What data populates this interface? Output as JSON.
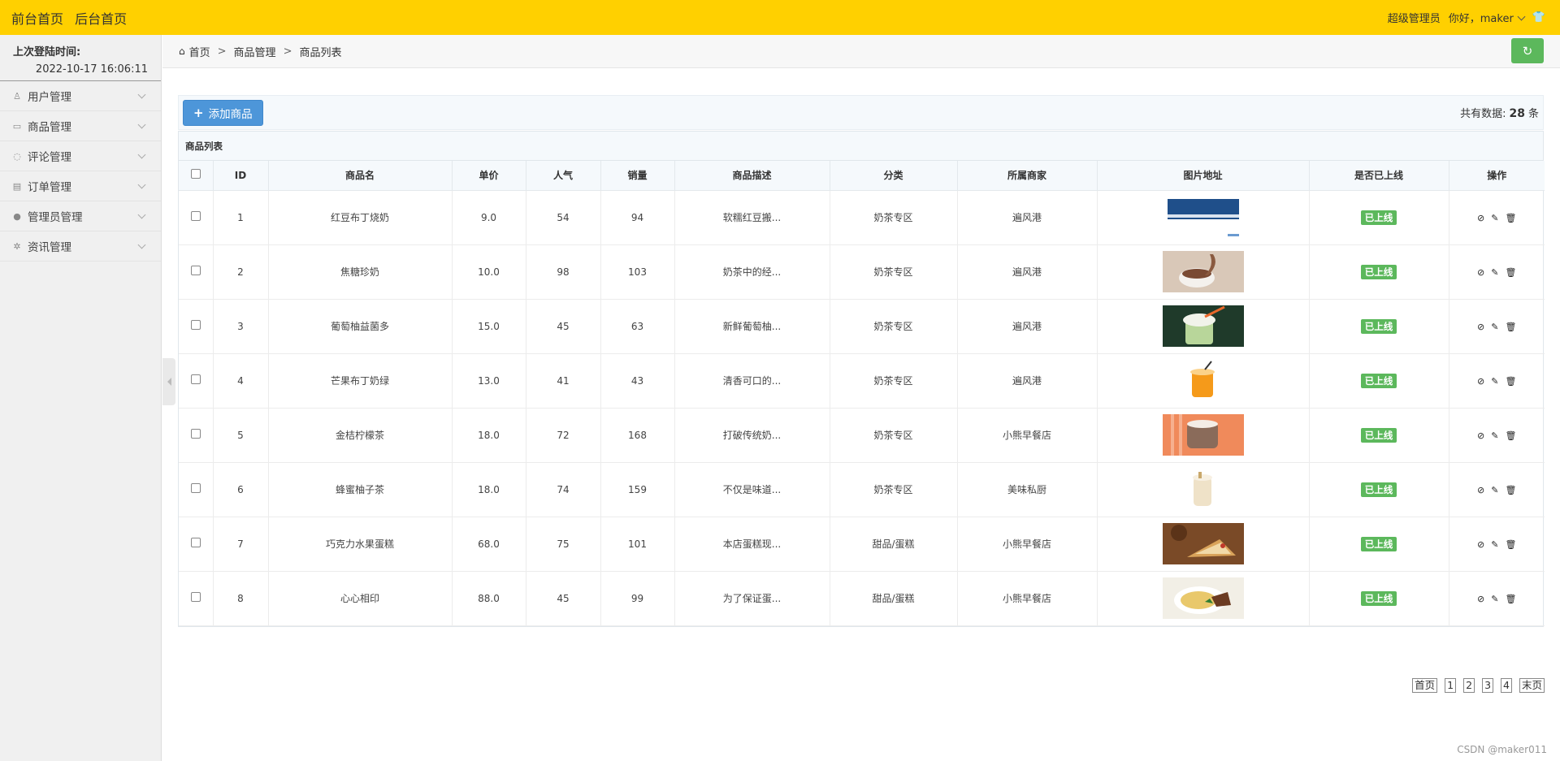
{
  "topbar": {
    "links": [
      "前台首页",
      "后台首页"
    ],
    "role": "超级管理员",
    "greeting": "你好，maker",
    "shirt_icon": "👕"
  },
  "sidebar": {
    "last_login_label": "上次登陆时间:",
    "last_login_value": "2022-10-17 16:06:11",
    "items": [
      {
        "label": "用户管理",
        "icon": "user-icon",
        "glyph": "♙"
      },
      {
        "label": "商品管理",
        "icon": "bag-icon",
        "glyph": "▭"
      },
      {
        "label": "评论管理",
        "icon": "comment-icon",
        "glyph": "◌"
      },
      {
        "label": "订单管理",
        "icon": "image-icon",
        "glyph": "▤"
      },
      {
        "label": "管理员管理",
        "icon": "person-icon",
        "glyph": "●"
      },
      {
        "label": "资讯管理",
        "icon": "gear-icon",
        "glyph": "✲"
      }
    ]
  },
  "breadcrumb": {
    "home": "首页",
    "level1": "商品管理",
    "level2": "商品列表",
    "home_glyph": "⌂",
    "refresh_glyph": "↻"
  },
  "toolbar": {
    "add_label": "添加商品",
    "total_prefix": "共有数据:",
    "total_count": "28",
    "total_suffix": "条"
  },
  "table": {
    "title": "商品列表",
    "headers": [
      "ID",
      "商品名",
      "单价",
      "人气",
      "销量",
      "商品描述",
      "分类",
      "所属商家",
      "图片地址",
      "是否已上线",
      "操作"
    ],
    "rows": [
      {
        "id": "1",
        "name": "红豆布丁烧奶",
        "price": "9.0",
        "pop": "54",
        "sales": "94",
        "desc": "软糯红豆搬...",
        "cat": "奶茶专区",
        "shop": "遍风港",
        "status": "已上线"
      },
      {
        "id": "2",
        "name": "焦糖珍奶",
        "price": "10.0",
        "pop": "98",
        "sales": "103",
        "desc": "奶茶中的经...",
        "cat": "奶茶专区",
        "shop": "遍风港",
        "status": "已上线"
      },
      {
        "id": "3",
        "name": "葡萄柚益菌多",
        "price": "15.0",
        "pop": "45",
        "sales": "63",
        "desc": "新鲜葡萄柚...",
        "cat": "奶茶专区",
        "shop": "遍风港",
        "status": "已上线"
      },
      {
        "id": "4",
        "name": "芒果布丁奶绿",
        "price": "13.0",
        "pop": "41",
        "sales": "43",
        "desc": "清香可口的...",
        "cat": "奶茶专区",
        "shop": "遍风港",
        "status": "已上线"
      },
      {
        "id": "5",
        "name": "金桔柠檬茶",
        "price": "18.0",
        "pop": "72",
        "sales": "168",
        "desc": "打破传统奶...",
        "cat": "奶茶专区",
        "shop": "小熊早餐店",
        "status": "已上线"
      },
      {
        "id": "6",
        "name": "蜂蜜柚子茶",
        "price": "18.0",
        "pop": "74",
        "sales": "159",
        "desc": "不仅是味道...",
        "cat": "奶茶专区",
        "shop": "美味私厨",
        "status": "已上线"
      },
      {
        "id": "7",
        "name": "巧克力水果蛋糕",
        "price": "68.0",
        "pop": "75",
        "sales": "101",
        "desc": "本店蛋糕现...",
        "cat": "甜品/蛋糕",
        "shop": "小熊早餐店",
        "status": "已上线"
      },
      {
        "id": "8",
        "name": "心心相印",
        "price": "88.0",
        "pop": "45",
        "sales": "99",
        "desc": "为了保证蛋...",
        "cat": "甜品/蛋糕",
        "shop": "小熊早餐店",
        "status": "已上线"
      }
    ],
    "op_glyphs": [
      "⊘",
      "✎",
      "🗑"
    ]
  },
  "pager": [
    "首页",
    "1",
    "2",
    "3",
    "4",
    "末页"
  ],
  "watermark": "CSDN @maker011"
}
